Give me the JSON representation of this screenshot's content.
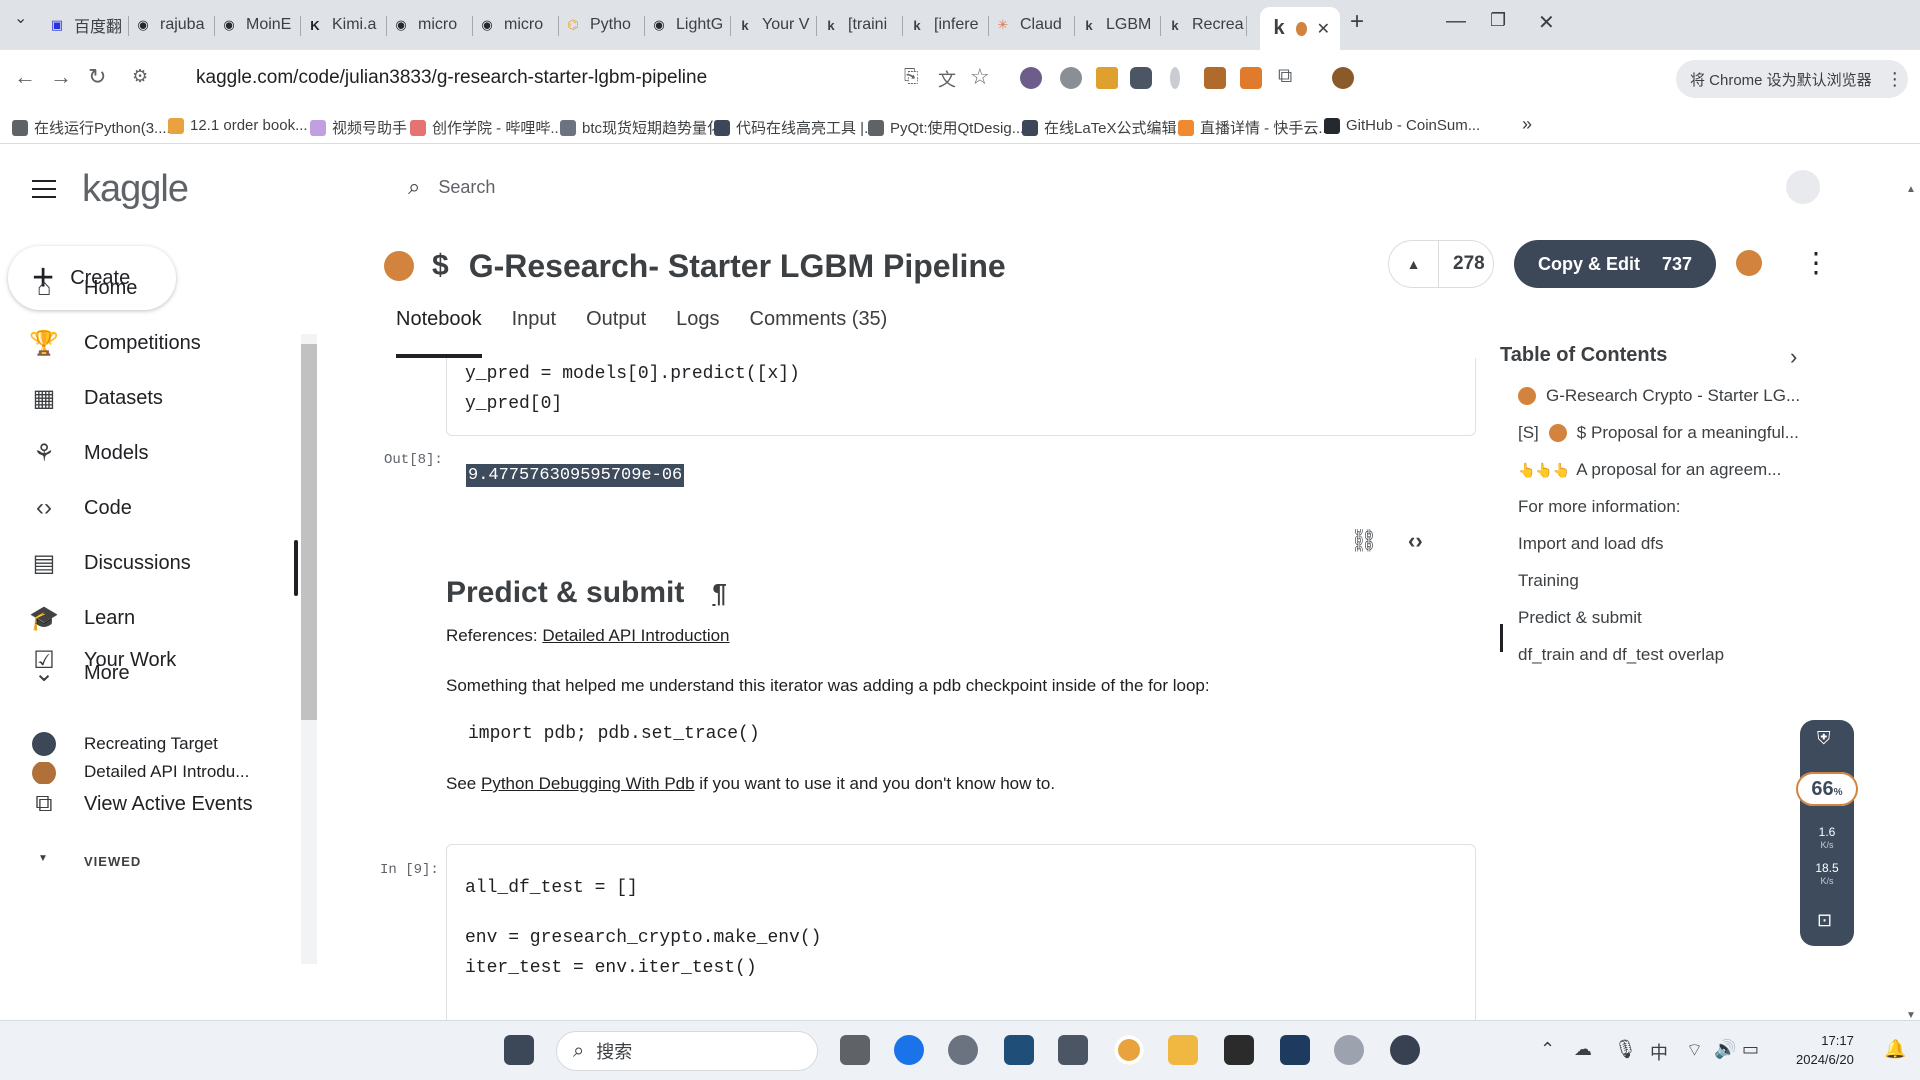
{
  "browser": {
    "tabs": [
      {
        "label": "百度翻",
        "icon": "baidu-icon",
        "color": "#2932e1"
      },
      {
        "label": "rajuba",
        "icon": "github-icon",
        "color": "#24292f"
      },
      {
        "label": "MoinE",
        "icon": "github-icon",
        "color": "#24292f"
      },
      {
        "label": "Kimi.a",
        "icon": "kimi-icon",
        "color": "#222222"
      },
      {
        "label": "micro",
        "icon": "github-icon",
        "color": "#24292f"
      },
      {
        "label": "micro",
        "icon": "github-icon",
        "color": "#24292f"
      },
      {
        "label": "Pytho",
        "icon": "python-icon",
        "color": "#f0a030"
      },
      {
        "label": "LightG",
        "icon": "github-icon",
        "color": "#24292f"
      },
      {
        "label": "Your V",
        "icon": "kaggle-icon",
        "color": "#3c4043"
      },
      {
        "label": "[traini",
        "icon": "kaggle-icon",
        "color": "#3c4043"
      },
      {
        "label": "[infere",
        "icon": "kaggle-icon",
        "color": "#3c4043"
      },
      {
        "label": "Claud",
        "icon": "claude-icon",
        "color": "#d97757"
      },
      {
        "label": "LGBM",
        "icon": "kaggle-icon",
        "color": "#3c4043"
      },
      {
        "label": "Recrea",
        "icon": "kaggle-icon",
        "color": "#3c4043"
      }
    ],
    "active_tab_icon": "kaggle-icon",
    "new_tab": "+",
    "url": "kaggle.com/code/julian3833/g-research-starter-lgbm-pipeline",
    "default_browser_prompt": "将 Chrome 设为默认浏览器",
    "bookmarks": [
      "在线运行Python(3....",
      "12.1 order book...",
      "视频号助手",
      "创作学院 - 哔哩哔...",
      "btc现货短期趋势量化",
      "代码在线高亮工具 |...",
      "PyQt:使用QtDesig...",
      "在线LaTeX公式编辑...",
      "直播详情 - 快手云...",
      "GitHub - CoinSum..."
    ],
    "bookmarks_more": "»"
  },
  "kaggle": {
    "logo": "kaggle",
    "create_label": "Create",
    "search_placeholder": "Search",
    "nav": [
      {
        "label": "Home",
        "icon": "home-icon"
      },
      {
        "label": "Competitions",
        "icon": "trophy-icon"
      },
      {
        "label": "Datasets",
        "icon": "table-icon"
      },
      {
        "label": "Models",
        "icon": "models-icon"
      },
      {
        "label": "Code",
        "icon": "code-icon"
      },
      {
        "label": "Discussions",
        "icon": "comment-icon"
      },
      {
        "label": "Learn",
        "icon": "school-icon"
      },
      {
        "label": "More",
        "icon": "chevron-down-icon"
      }
    ],
    "your_work": "Your Work",
    "viewed_label": "VIEWED",
    "viewed_items": [
      "Recreating Target",
      "Detailed API Introdu..."
    ],
    "view_active_events": "View Active Events",
    "notebook": {
      "currency_symbol": "$",
      "title": "G-Research- Starter LGBM Pipeline",
      "upvotes": "278",
      "copy_edit_label": "Copy & Edit",
      "copy_edit_count": "737",
      "tabs": [
        "Notebook",
        "Input",
        "Output",
        "Logs",
        "Comments (35)"
      ],
      "active_tab": "Notebook"
    },
    "cells": {
      "prev_code": [
        "y_pred = models[0].predict([x])",
        "y_pred[0]"
      ],
      "out_prompt": "Out[8]:",
      "out_value": "9.477576309595709e-06",
      "section_title": "Predict & submit",
      "pilcrow": "¶",
      "refs_prefix": "References: ",
      "refs_link": "Detailed API Introduction",
      "para1": "Something that helped me understand this iterator was adding a pdb checkpoint inside of the for loop:",
      "md_code": "import pdb; pdb.set_trace()",
      "para2_prefix": "See ",
      "para2_link": "Python Debugging With Pdb",
      "para2_suffix": " if you want to use it and you don't know how to.",
      "in_prompt": "In [9]:",
      "code9": [
        "all_df_test = []",
        "",
        "env = gresearch_crypto.make_env()",
        "iter_test = env.iter_test()"
      ]
    },
    "toc": {
      "title": "Table of Contents",
      "items": [
        {
          "prefix": "",
          "label": "G-Research Crypto - Starter LG..."
        },
        {
          "prefix": "[S]",
          "label": "$  Proposal for a meaningful..."
        },
        {
          "prefix": "👆👆👆",
          "label": "A proposal for an agreem..."
        },
        {
          "prefix": "",
          "label": "For more information:"
        },
        {
          "prefix": "",
          "label": "Import and load dfs"
        },
        {
          "prefix": "",
          "label": "Training"
        },
        {
          "prefix": "",
          "label": "Predict & submit"
        },
        {
          "prefix": "",
          "label": "df_train and df_test overlap"
        }
      ],
      "active": "Training"
    }
  },
  "net_widget": {
    "percent": "66",
    "percent_unit": "%",
    "upload": "1.6",
    "upload_unit": "K/s",
    "download": "18.5",
    "download_unit": "K/s"
  },
  "taskbar": {
    "search_label": "搜索",
    "ime": "中",
    "time": "17:17",
    "date": "2024/6/20"
  },
  "colors": {
    "accent": "#d2843f",
    "button_dark": "#3c4858"
  }
}
